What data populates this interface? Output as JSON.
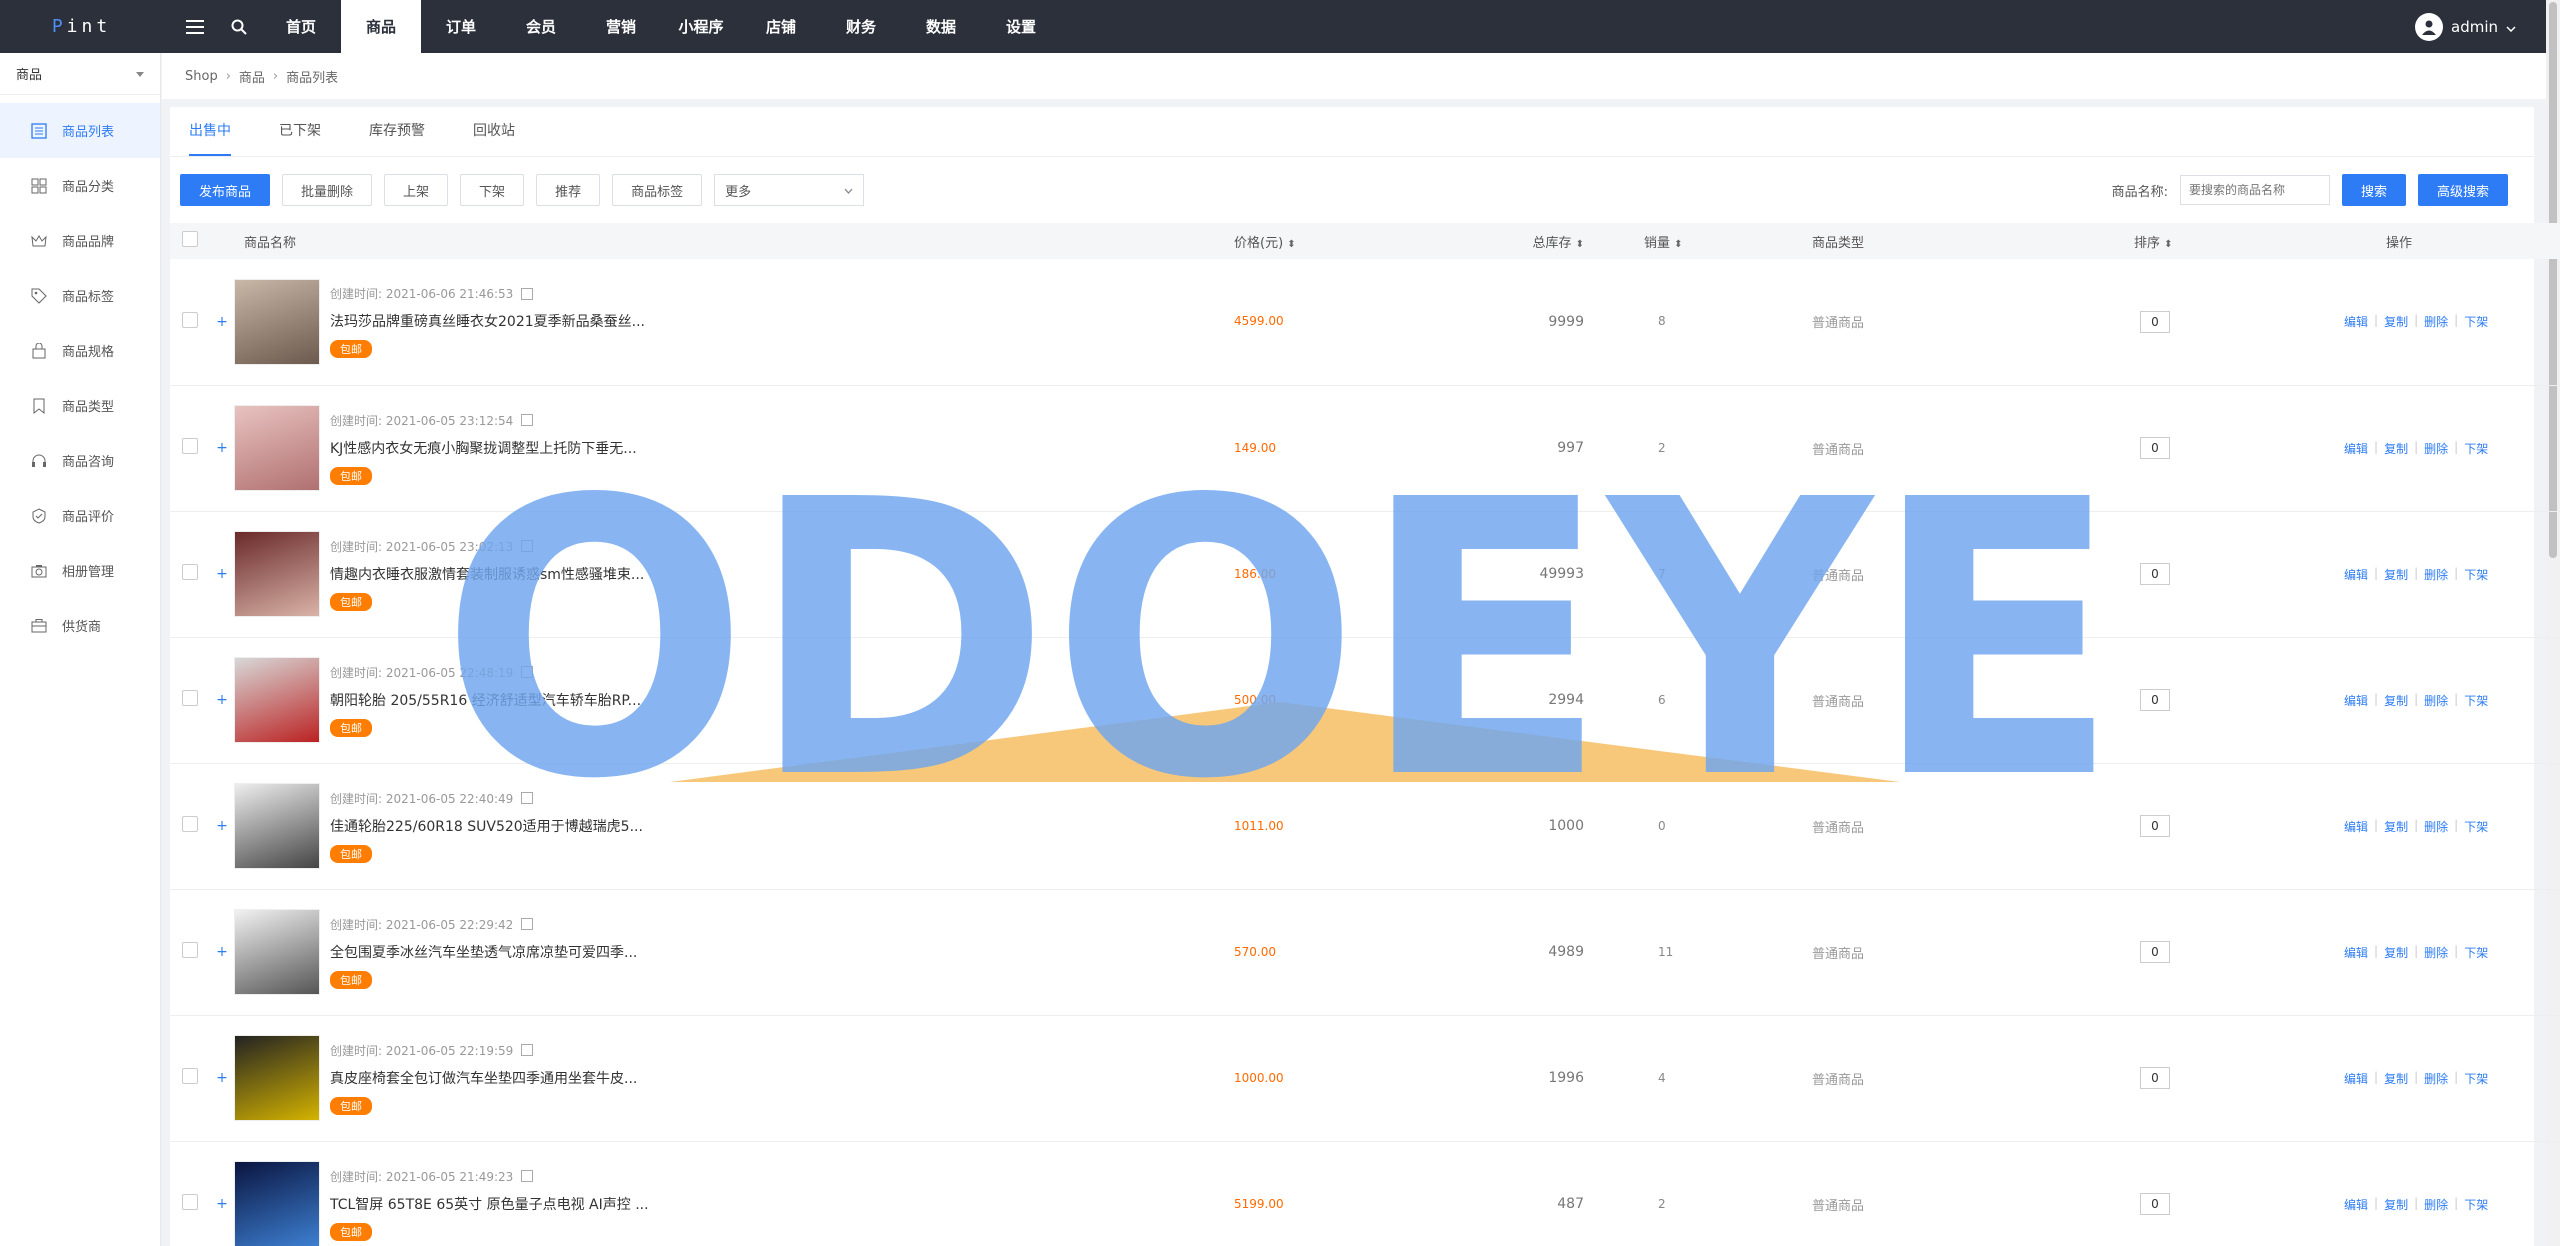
{
  "topbar": {
    "logo_first": "P",
    "logo_rest": "int",
    "nav": [
      "首页",
      "商品",
      "订单",
      "会员",
      "营销",
      "小程序",
      "店铺",
      "财务",
      "数据",
      "设置"
    ],
    "active_nav": 1,
    "user": "admin"
  },
  "sidebar": {
    "header": "商品",
    "items": [
      {
        "label": "商品列表",
        "icon": "list-icon"
      },
      {
        "label": "商品分类",
        "icon": "grid-icon"
      },
      {
        "label": "商品品牌",
        "icon": "crown-icon"
      },
      {
        "label": "商品标签",
        "icon": "tag-icon"
      },
      {
        "label": "商品规格",
        "icon": "bag-icon"
      },
      {
        "label": "商品类型",
        "icon": "bookmark-icon"
      },
      {
        "label": "商品咨询",
        "icon": "headset-icon"
      },
      {
        "label": "商品评价",
        "icon": "badge-icon"
      },
      {
        "label": "相册管理",
        "icon": "camera-icon"
      },
      {
        "label": "供货商",
        "icon": "briefcase-icon"
      }
    ]
  },
  "breadcrumb": [
    "Shop",
    "商品",
    "商品列表"
  ],
  "tabs": [
    "出售中",
    "已下架",
    "库存预警",
    "回收站"
  ],
  "toolbar": {
    "publish": "发布商品",
    "batch_delete": "批量删除",
    "on_shelf": "上架",
    "off_shelf": "下架",
    "recommend": "推荐",
    "tags": "商品标签",
    "more": "更多",
    "search_label": "商品名称:",
    "search_placeholder": "要搜索的商品名称",
    "search": "搜索",
    "advanced": "高级搜索"
  },
  "table": {
    "headers": {
      "name": "商品名称",
      "price": "价格(元)",
      "stock": "总库存",
      "sales": "销量",
      "type": "商品类型",
      "sort": "排序",
      "ops": "操作"
    },
    "ops": [
      "编辑",
      "复制",
      "删除",
      "下架"
    ],
    "tag": "包邮",
    "rows": [
      {
        "created": "创建时间: 2021-06-06 21:46:53",
        "name": "法玛莎品牌重磅真丝睡衣女2021夏季新品桑蚕丝...",
        "price": "4599.00",
        "stock": "9999",
        "sales": "8",
        "type": "普通商品",
        "sort": "0"
      },
      {
        "created": "创建时间: 2021-06-05 23:12:54",
        "name": "KJ性感内衣女无痕小胸聚拢调整型上托防下垂无...",
        "price": "149.00",
        "stock": "997",
        "sales": "2",
        "type": "普通商品",
        "sort": "0"
      },
      {
        "created": "创建时间: 2021-06-05 23:02:13",
        "name": "情趣内衣睡衣服激情套装制服诱惑sm性感骚堆束...",
        "price": "186.00",
        "stock": "49993",
        "sales": "7",
        "type": "普通商品",
        "sort": "0"
      },
      {
        "created": "创建时间: 2021-06-05 22:48:19",
        "name": "朝阳轮胎 205/55R16 经济舒适型汽车轿车胎RP...",
        "price": "500.00",
        "stock": "2994",
        "sales": "6",
        "type": "普通商品",
        "sort": "0"
      },
      {
        "created": "创建时间: 2021-06-05 22:40:49",
        "name": "佳通轮胎225/60R18 SUV520适用于博越瑞虎5...",
        "price": "1011.00",
        "stock": "1000",
        "sales": "0",
        "type": "普通商品",
        "sort": "0"
      },
      {
        "created": "创建时间: 2021-06-05 22:29:42",
        "name": "全包围夏季冰丝汽车坐垫透气凉席凉垫可爱四季...",
        "price": "570.00",
        "stock": "4989",
        "sales": "11",
        "type": "普通商品",
        "sort": "0"
      },
      {
        "created": "创建时间: 2021-06-05 22:19:59",
        "name": "真皮座椅套全包订做汽车坐垫四季通用坐套牛皮...",
        "price": "1000.00",
        "stock": "1996",
        "sales": "4",
        "type": "普通商品",
        "sort": "0"
      },
      {
        "created": "创建时间: 2021-06-05 21:49:23",
        "name": "TCL智屏 65T8E 65英寸 原色量子点电视 AI声控 ...",
        "price": "5199.00",
        "stock": "487",
        "sales": "2",
        "type": "普通商品",
        "sort": "0"
      }
    ]
  },
  "watermark": "ODOEYE",
  "colors": {
    "accent": "#2d7cf6",
    "topbar": "#2b303b",
    "price": "#ff6a00",
    "tag": "#ff7d00",
    "watermark_blue": "#6fa6ee",
    "watermark_orange": "#f7c26b"
  }
}
